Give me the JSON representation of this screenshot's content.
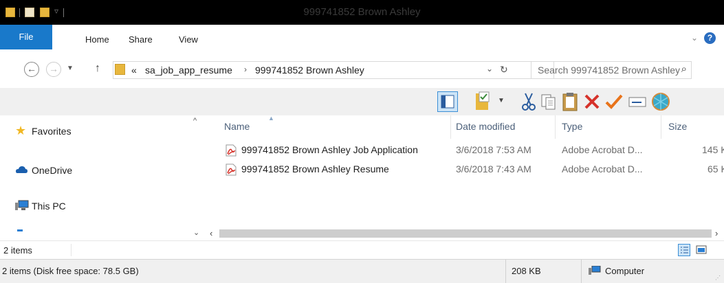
{
  "window": {
    "title": "999741852 Brown Ashley"
  },
  "ribbon": {
    "tabs": {
      "file": "File",
      "home": "Home",
      "share": "Share",
      "view": "View"
    },
    "help_symbol": "?",
    "collapse_symbol": "⌄"
  },
  "address": {
    "overflow": "«",
    "segments": [
      "sa_job_app_resume",
      "999741852 Brown Ashley"
    ],
    "separator": "›",
    "dropdown_symbol": "⌄",
    "refresh_symbol": "↻"
  },
  "search": {
    "placeholder": "Search 999741852 Brown Ashley"
  },
  "navpane": {
    "items": [
      {
        "label": "Favorites",
        "icon": "star-icon"
      },
      {
        "label": "OneDrive",
        "icon": "cloud-icon"
      },
      {
        "label": "This PC",
        "icon": "computer-icon"
      }
    ]
  },
  "columns": {
    "name": "Name",
    "date": "Date modified",
    "type": "Type",
    "size": "Size"
  },
  "files": [
    {
      "name": "999741852 Brown Ashley Job Application",
      "date": "3/6/2018 7:53 AM",
      "type": "Adobe Acrobat D...",
      "size": "145 K"
    },
    {
      "name": "999741852 Brown Ashley Resume",
      "date": "3/6/2018 7:43 AM",
      "type": "Adobe Acrobat D...",
      "size": "65 K"
    }
  ],
  "status": {
    "item_count": "2 items",
    "details": "2 items (Disk free space: 78.5 GB)",
    "size": "208 KB",
    "location": "Computer"
  },
  "colors": {
    "accent": "#1979ca",
    "title_bg": "#000000",
    "toolbar_bg": "#f0f0f0"
  }
}
